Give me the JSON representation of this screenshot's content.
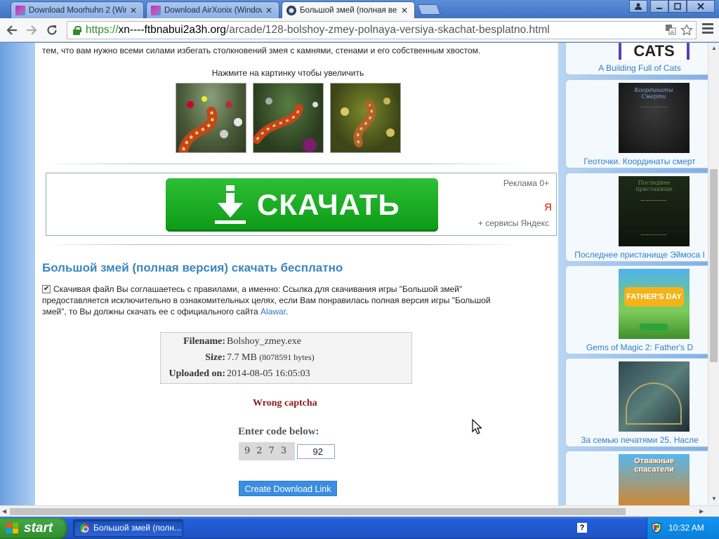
{
  "browser": {
    "tabs": [
      {
        "title": "Download Moorhuhn 2 (Wind",
        "icon": "alawar-favicon",
        "active": false
      },
      {
        "title": "Download AirXonix (Windows",
        "icon": "alawar-favicon",
        "active": false
      },
      {
        "title": "Большой змей (полная верс",
        "icon": "site-favicon",
        "active": true
      }
    ],
    "close_glyph": "✕",
    "url": {
      "scheme": "https://",
      "host": "xn----ftbnabui2a3h.org",
      "path": "/arcade/128-bolshoy-zmey-polnaya-versiya-skachat-besplatno.html"
    }
  },
  "page": {
    "intro_text": "тем, что вам нужно всеми силами избегать столкновений змея с камнями, стенами и его собственным хвостом.",
    "click_hint": "Нажмите на картинку чтобы увеличить",
    "ad": {
      "button_label": "СКАЧАТЬ",
      "ad_label": "Реклама 0+",
      "yandex_logo": "Я",
      "services": "+ сервисы Яндекс"
    },
    "heading": "Большой змей (полная версия) скачать бесплатно",
    "agreement_before": "Скачивая файл Вы соглашаетесь с правилами, а именно: Ссылка для скачивания игры \"Большой змей\" предоставляется исключительно в ознакомительных целях, если Вам понравилась полная версия игры \"Большой змей\", то Вы должны скачать ее с официального сайта ",
    "agreement_link": "Alawar",
    "agreement_after": ".",
    "file": {
      "filename_label": "Filename:",
      "filename": "Bolshoy_zmey.exe",
      "size_label": "Size:",
      "size": "7.7 MB",
      "size_bytes": "(8078591 bytes)",
      "uploaded_label": "Uploaded on:",
      "uploaded": "2014-08-05 16:05:03"
    },
    "captcha": {
      "error": "Wrong captcha",
      "prompt": "Enter code below:",
      "code_image_text": "9273",
      "input_value": "92",
      "submit": "Create Download Link"
    }
  },
  "sidebar": {
    "items": [
      {
        "caption": "A Building Full of Cats",
        "thumb_text": "CATS"
      },
      {
        "caption": "Геоточки. Координаты смерт",
        "thumb_text": "Координаты Смерти"
      },
      {
        "caption": "Последнее пристанище Эймоса I",
        "thumb_text": "Последнее пристанище"
      },
      {
        "caption": "Gems of Magic 2: Father's D",
        "thumb_text": "FATHER'S DAY"
      },
      {
        "caption": "За семью печатями 25. Насле",
        "thumb_text": ""
      },
      {
        "caption": "",
        "thumb_text": "Отважные спасатели"
      }
    ]
  },
  "taskbar": {
    "start_label": "start",
    "task_title": "Большой змей (полн...",
    "help_glyph": "?",
    "clock": "10:32 AM"
  }
}
